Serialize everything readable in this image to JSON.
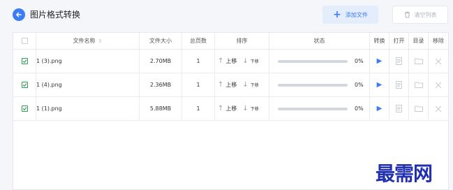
{
  "header": {
    "title": "图片格式转换",
    "add_label": "添加文件",
    "clear_label": "清空列表"
  },
  "table": {
    "columns": [
      "",
      "文件名称",
      "文件大小",
      "总页数",
      "排序",
      "状态",
      "转换",
      "打开",
      "目录",
      "移除"
    ],
    "sort_up_label": "上移",
    "sort_down_label": "下移",
    "rows": [
      {
        "checked": true,
        "name": "1 (3).png",
        "size": "2.70MB",
        "pages": "1",
        "progress": 0,
        "progress_text": "0%"
      },
      {
        "checked": true,
        "name": "1 (4).png",
        "size": "2.36MB",
        "pages": "1",
        "progress": 0,
        "progress_text": "0%"
      },
      {
        "checked": true,
        "name": "1 (1).png",
        "size": "5.88MB",
        "pages": "1",
        "progress": 0,
        "progress_text": "0%"
      }
    ]
  },
  "watermark": "最需网",
  "colors": {
    "accent": "#3d7cf5",
    "check": "#2ea04e",
    "watermark": "#2030b0"
  },
  "icons": [
    "back-arrow-icon",
    "plus-icon",
    "trash-icon",
    "sort-caret-icon",
    "arrow-up-icon",
    "arrow-down-icon",
    "play-icon",
    "document-icon",
    "folder-icon",
    "close-icon"
  ]
}
